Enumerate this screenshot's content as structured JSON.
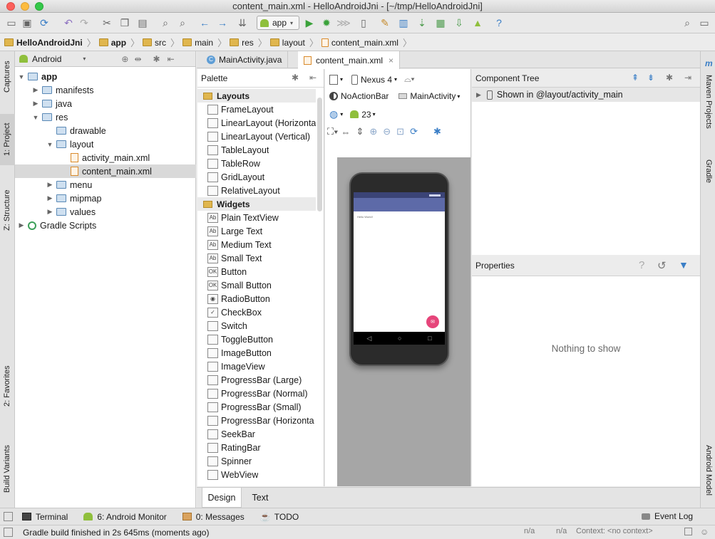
{
  "window": {
    "title": "content_main.xml - HelloAndroidJni - [~/tmp/HelloAndroidJni]"
  },
  "toolbar": {
    "run_config": "app"
  },
  "breadcrumb": [
    "HelloAndroidJni",
    "app",
    "src",
    "main",
    "res",
    "layout",
    "content_main.xml"
  ],
  "left_tool_windows": [
    "1: Project",
    "Captures",
    "Z: Structure",
    "2: Favorites",
    "Build Variants"
  ],
  "right_tool_windows": [
    "Maven Projects",
    "Gradle",
    "Android Model"
  ],
  "project": {
    "view_mode": "Android",
    "tree": [
      {
        "label": "app",
        "depth": 0,
        "expanded": true,
        "bold": true
      },
      {
        "label": "manifests",
        "depth": 1,
        "expanded": false
      },
      {
        "label": "java",
        "depth": 1,
        "expanded": false
      },
      {
        "label": "res",
        "depth": 1,
        "expanded": true
      },
      {
        "label": "drawable",
        "depth": 2,
        "expanded": null
      },
      {
        "label": "layout",
        "depth": 2,
        "expanded": true
      },
      {
        "label": "activity_main.xml",
        "depth": 3,
        "file": true
      },
      {
        "label": "content_main.xml",
        "depth": 3,
        "file": true,
        "selected": true
      },
      {
        "label": "menu",
        "depth": 2,
        "expanded": false
      },
      {
        "label": "mipmap",
        "depth": 2,
        "expanded": false
      },
      {
        "label": "values",
        "depth": 2,
        "expanded": false
      },
      {
        "label": "Gradle Scripts",
        "depth": 0,
        "expanded": false,
        "gradle": true
      }
    ]
  },
  "editor_tabs": [
    {
      "label": "MainActivity.java",
      "active": false
    },
    {
      "label": "content_main.xml",
      "active": true
    }
  ],
  "palette": {
    "title": "Palette",
    "categories": [
      {
        "name": "Layouts",
        "items": [
          "FrameLayout",
          "LinearLayout (Horizonta",
          "LinearLayout (Vertical)",
          "TableLayout",
          "TableRow",
          "GridLayout",
          "RelativeLayout"
        ]
      },
      {
        "name": "Widgets",
        "items": [
          "Plain TextView",
          "Large Text",
          "Medium Text",
          "Small Text",
          "Button",
          "Small Button",
          "RadioButton",
          "CheckBox",
          "Switch",
          "ToggleButton",
          "ImageButton",
          "ImageView",
          "ProgressBar (Large)",
          "ProgressBar (Normal)",
          "ProgressBar (Small)",
          "ProgressBar (Horizonta",
          "SeekBar",
          "RatingBar",
          "Spinner",
          "WebView"
        ]
      }
    ]
  },
  "design_toolbar": {
    "device": "Nexus 4",
    "theme": "NoActionBar",
    "activity": "MainActivity",
    "api": "23"
  },
  "preview": {
    "text": "Hello World!"
  },
  "component_tree": {
    "title": "Component Tree",
    "root": "Shown in @layout/activity_main"
  },
  "properties": {
    "title": "Properties",
    "empty_text": "Nothing to show"
  },
  "design_tabs": [
    {
      "label": "Design",
      "active": true
    },
    {
      "label": "Text",
      "active": false
    }
  ],
  "bottom_tools": [
    {
      "label": "Terminal"
    },
    {
      "label": "6: Android Monitor"
    },
    {
      "label": "0: Messages"
    },
    {
      "label": "TODO"
    }
  ],
  "event_log": "Event Log",
  "status": {
    "message": "Gradle build finished in 2s 645ms (moments ago)",
    "cell1": "n/a",
    "cell2": "n/a",
    "context": "Context: <no context>"
  }
}
